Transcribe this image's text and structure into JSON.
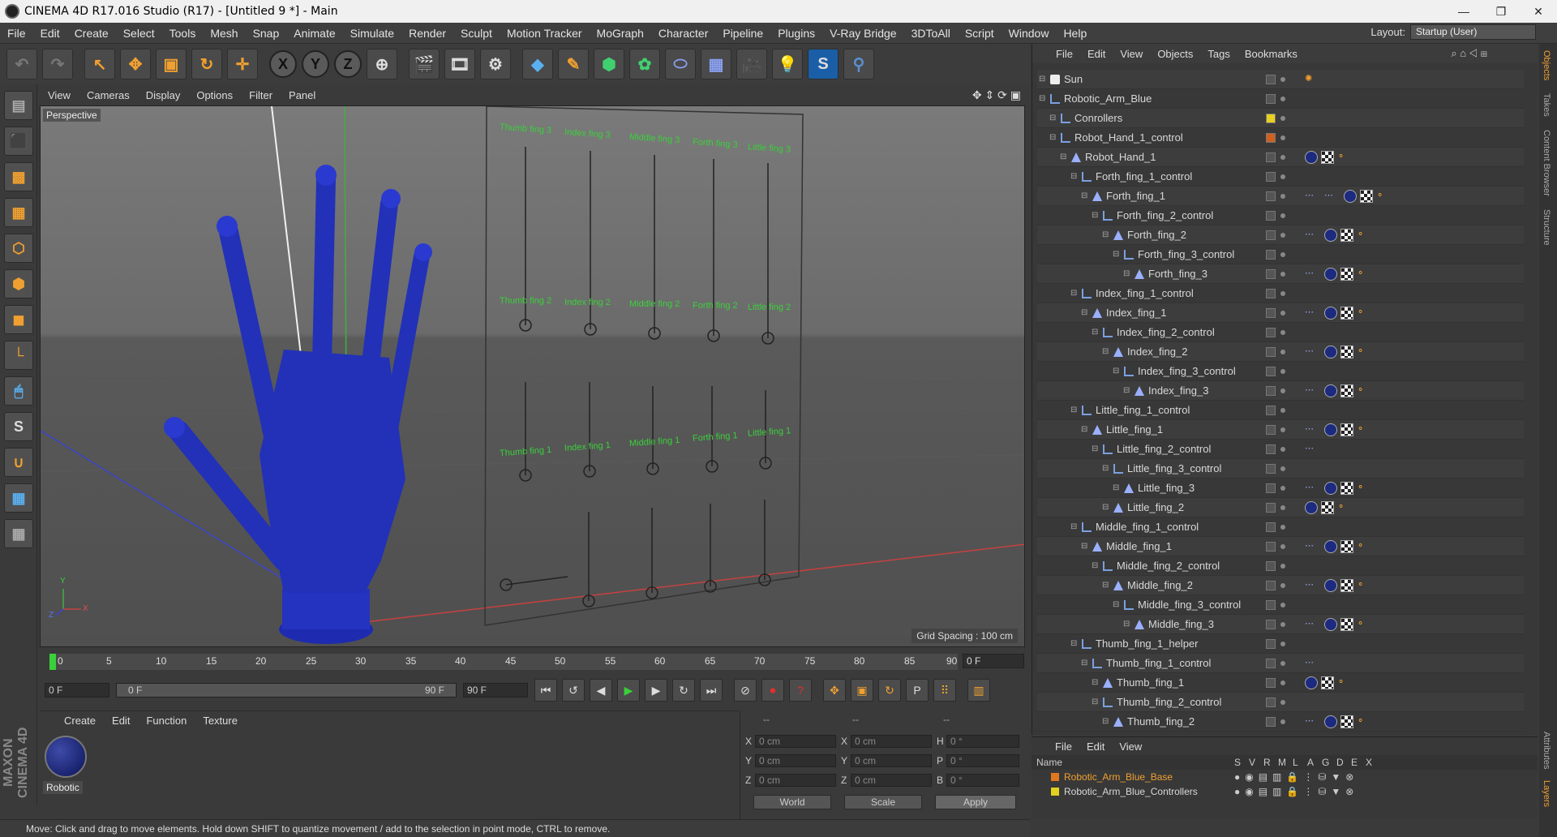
{
  "window": {
    "title": "CINEMA 4D R17.016 Studio (R17) - [Untitled 9 *] - Main",
    "minimize": "—",
    "maximize": "❐",
    "close": "✕"
  },
  "menu": [
    "File",
    "Edit",
    "Create",
    "Select",
    "Tools",
    "Mesh",
    "Snap",
    "Animate",
    "Simulate",
    "Render",
    "Sculpt",
    "Motion Tracker",
    "MoGraph",
    "Character",
    "Pipeline",
    "Plugins",
    "V-Ray Bridge",
    "3DToAll",
    "Script",
    "Window",
    "Help"
  ],
  "layout": {
    "label": "Layout:",
    "value": "Startup (User)"
  },
  "viewport": {
    "menu": [
      "View",
      "Cameras",
      "Display",
      "Options",
      "Filter",
      "Panel"
    ],
    "label": "Perspective",
    "grid_spacing": "Grid Spacing : 100 cm",
    "board_labels": {
      "row1": [
        "Thumb fing 3",
        "Index fing 3",
        "Middle fing 3",
        "Forth fing 3",
        "Little fing 3"
      ],
      "row2": [
        "Thumb fing 2",
        "Index fing 2",
        "Middle fing 2",
        "Forth fing 2",
        "Little fing 2"
      ],
      "row3": [
        "Thumb fing 1",
        "Index fing 1",
        "Middle fing 1",
        "Forth fing 1",
        "Little fing 1"
      ]
    },
    "axis_y": "Y",
    "axis_z": "Z",
    "axis_x": "X"
  },
  "timeline": {
    "ticks": [
      "0",
      "5",
      "10",
      "15",
      "20",
      "25",
      "30",
      "35",
      "40",
      "45",
      "50",
      "55",
      "60",
      "65",
      "70",
      "75",
      "80",
      "85",
      "90"
    ],
    "current": "0 F"
  },
  "transport": {
    "start": "0 F",
    "range_start": "0 F",
    "range_end": "90 F",
    "end": "90 F"
  },
  "material": {
    "menu": [
      "Create",
      "Edit",
      "Function",
      "Texture"
    ],
    "name": "Robotic"
  },
  "coords": {
    "header": [
      "--",
      "--",
      "--"
    ],
    "rows": [
      {
        "a": "X",
        "av": "0 cm",
        "b": "X",
        "bv": "0 cm",
        "c": "H",
        "cv": "0 °"
      },
      {
        "a": "Y",
        "av": "0 cm",
        "b": "Y",
        "bv": "0 cm",
        "c": "P",
        "cv": "0 °"
      },
      {
        "a": "Z",
        "av": "0 cm",
        "b": "Z",
        "bv": "0 cm",
        "c": "B",
        "cv": "0 °"
      }
    ],
    "world": "World",
    "scale": "Scale",
    "apply": "Apply"
  },
  "status": "Move: Click and drag to move elements. Hold down SHIFT to quantize movement / add to the selection in point mode, CTRL to remove.",
  "objects": {
    "menu": [
      "File",
      "Edit",
      "View",
      "Objects",
      "Tags",
      "Bookmarks"
    ],
    "items": [
      {
        "name": "Sun",
        "type": "sun",
        "indent": 0,
        "tags": "sun"
      },
      {
        "name": "Robotic_Arm_Blue",
        "type": "null",
        "indent": 0,
        "tags": ""
      },
      {
        "name": "Conrollers",
        "type": "null",
        "indent": 1,
        "tags": "",
        "flag": "#e8d020"
      },
      {
        "name": "Robot_Hand_1_control",
        "type": "null",
        "indent": 1,
        "tags": "",
        "flag": "#d06020"
      },
      {
        "name": "Robot_Hand_1",
        "type": "joint",
        "indent": 2,
        "tags": "mat"
      },
      {
        "name": "Forth_fing_1_control",
        "type": "null",
        "indent": 3,
        "tags": ""
      },
      {
        "name": "Forth_fing_1",
        "type": "joint",
        "indent": 4,
        "tags": "full2"
      },
      {
        "name": "Forth_fing_2_control",
        "type": "null",
        "indent": 5,
        "tags": ""
      },
      {
        "name": "Forth_fing_2",
        "type": "joint",
        "indent": 6,
        "tags": "full"
      },
      {
        "name": "Forth_fing_3_control",
        "type": "null",
        "indent": 7,
        "tags": ""
      },
      {
        "name": "Forth_fing_3",
        "type": "joint",
        "indent": 8,
        "tags": "full"
      },
      {
        "name": "Index_fing_1_control",
        "type": "null",
        "indent": 3,
        "tags": ""
      },
      {
        "name": "Index_fing_1",
        "type": "joint",
        "indent": 4,
        "tags": "full"
      },
      {
        "name": "Index_fing_2_control",
        "type": "null",
        "indent": 5,
        "tags": ""
      },
      {
        "name": "Index_fing_2",
        "type": "joint",
        "indent": 6,
        "tags": "full"
      },
      {
        "name": "Index_fing_3_control",
        "type": "null",
        "indent": 7,
        "tags": ""
      },
      {
        "name": "Index_fing_3",
        "type": "joint",
        "indent": 8,
        "tags": "full"
      },
      {
        "name": "Little_fing_1_control",
        "type": "null",
        "indent": 3,
        "tags": ""
      },
      {
        "name": "Little_fing_1",
        "type": "joint",
        "indent": 4,
        "tags": "full"
      },
      {
        "name": "Little_fing_2_control",
        "type": "null",
        "indent": 5,
        "tags": "dots"
      },
      {
        "name": "Little_fing_3_control",
        "type": "null",
        "indent": 6,
        "tags": ""
      },
      {
        "name": "Little_fing_3",
        "type": "joint",
        "indent": 7,
        "tags": "full"
      },
      {
        "name": "Little_fing_2",
        "type": "joint",
        "indent": 6,
        "tags": "mat"
      },
      {
        "name": "Middle_fing_1_control",
        "type": "null",
        "indent": 3,
        "tags": ""
      },
      {
        "name": "Middle_fing_1",
        "type": "joint",
        "indent": 4,
        "tags": "full"
      },
      {
        "name": "Middle_fing_2_control",
        "type": "null",
        "indent": 5,
        "tags": ""
      },
      {
        "name": "Middle_fing_2",
        "type": "joint",
        "indent": 6,
        "tags": "full"
      },
      {
        "name": "Middle_fing_3_control",
        "type": "null",
        "indent": 7,
        "tags": ""
      },
      {
        "name": "Middle_fing_3",
        "type": "joint",
        "indent": 8,
        "tags": "full"
      },
      {
        "name": "Thumb_fing_1_helper",
        "type": "null",
        "indent": 3,
        "tags": ""
      },
      {
        "name": "Thumb_fing_1_control",
        "type": "null",
        "indent": 4,
        "tags": "dots"
      },
      {
        "name": "Thumb_fing_1",
        "type": "joint",
        "indent": 5,
        "tags": "mat"
      },
      {
        "name": "Thumb_fing_2_control",
        "type": "null",
        "indent": 5,
        "tags": ""
      },
      {
        "name": "Thumb_fing_2",
        "type": "joint",
        "indent": 6,
        "tags": "full"
      }
    ]
  },
  "layers": {
    "menu": [
      "File",
      "Edit",
      "View"
    ],
    "columns": [
      "Name",
      "S",
      "V",
      "R",
      "M",
      "L",
      "A",
      "G",
      "D",
      "E",
      "X"
    ],
    "items": [
      {
        "name": "Robotic_Arm_Blue_Base",
        "color": "#e07820",
        "text_color": "#f0a030"
      },
      {
        "name": "Robotic_Arm_Blue_Controllers",
        "color": "#e0d020",
        "text_color": "#d8d8d8"
      }
    ]
  },
  "side_tabs": [
    "Objects",
    "Takes",
    "Content Browser",
    "Structure"
  ],
  "side_tabs_bottom": [
    "Attributes",
    "Layers"
  ],
  "maxon": "MAXON CINEMA 4D"
}
